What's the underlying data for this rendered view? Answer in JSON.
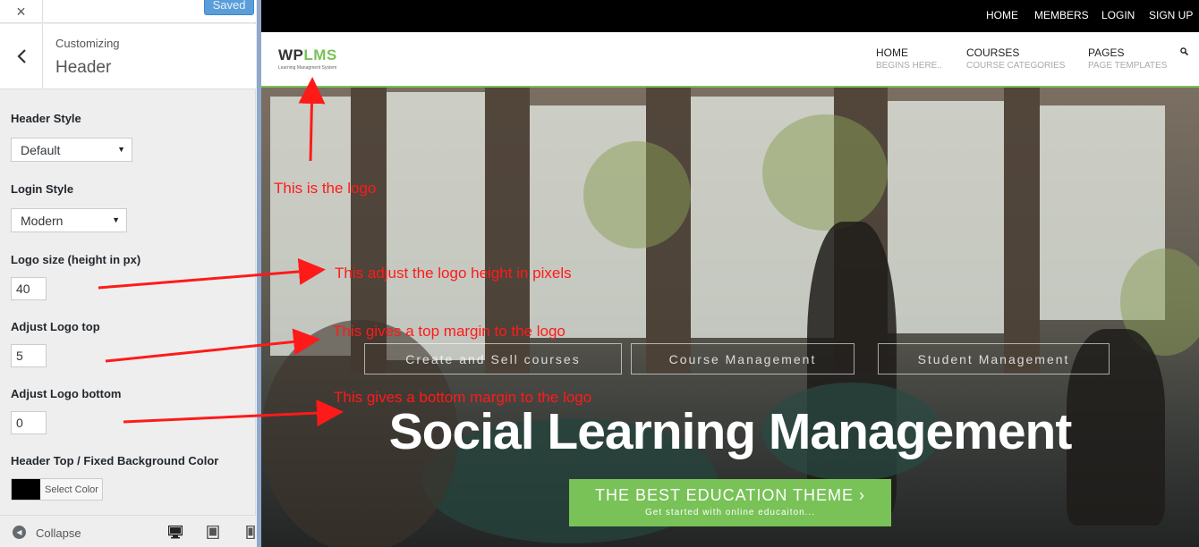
{
  "customizer": {
    "close_glyph": "×",
    "saved_label": "Saved",
    "back_glyph": "‹",
    "breadcrumb": "Customizing",
    "section_title": "Header",
    "controls": {
      "header_style_label": "Header Style",
      "header_style_value": "Default",
      "login_style_label": "Login Style",
      "login_style_value": "Modern",
      "logo_size_label": "Logo size (height in px)",
      "logo_size_value": "40",
      "logo_top_label": "Adjust Logo top",
      "logo_top_value": "5",
      "logo_bottom_label": "Adjust Logo bottom",
      "logo_bottom_value": "0",
      "bg_color_label": "Header Top / Fixed Background Color",
      "bg_color_value": "#000000",
      "select_color_label": "Select Color"
    },
    "footer": {
      "collapse_label": "Collapse",
      "devices": [
        "desktop-icon",
        "tablet-icon",
        "mobile-icon"
      ]
    }
  },
  "preview": {
    "top_links": [
      "HOME",
      "MEMBERS",
      "LOGIN",
      "SIGN UP"
    ],
    "logo": {
      "wp": "WP",
      "lms": "LMS",
      "tagline": "Learning Managment System"
    },
    "nav": [
      {
        "label": "HOME",
        "sub": "BEGINS HERE.."
      },
      {
        "label": "COURSES",
        "sub": "COURSE CATEGORIES"
      },
      {
        "label": "PAGES",
        "sub": "PAGE TEMPLATES"
      }
    ],
    "hero": {
      "buttons": [
        "Create and Sell courses",
        "Course Management",
        "Student Management"
      ],
      "title": "Social Learning Management",
      "cta_main": "THE BEST EDUCATION THEME ›",
      "cta_sub": "Get started with online educaiton..."
    }
  },
  "annotations": {
    "logo_note": "This is the logo",
    "height_note": "This adjust the logo height in pixels",
    "top_note": "This gives a top margin to the logo",
    "bottom_note": "This gives a bottom margin to the logo"
  },
  "colors": {
    "accent_green": "#78c257",
    "annotation_red": "#ff1a1a",
    "saved_blue": "#5b9dd9"
  }
}
